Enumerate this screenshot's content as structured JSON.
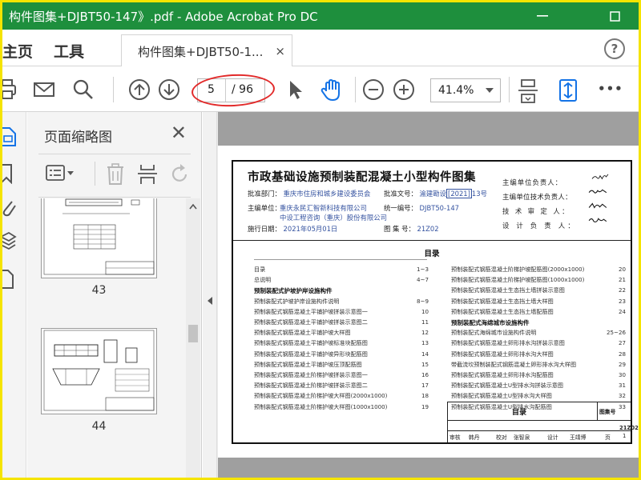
{
  "window": {
    "title": "构件图集+DJBT50-147》.pdf - Adobe Acrobat Pro DC",
    "minimize_glyph": "—",
    "maximize_glyph": "☐"
  },
  "nav": {
    "home": "主页",
    "tools": "工具",
    "tab_label": "构件图集+DJBT50-1...",
    "tab_close": "×",
    "help": "?"
  },
  "toolbar": {
    "page_current": "5",
    "page_total": "/ 96",
    "zoom": "41.4%",
    "more": "•••",
    "icons": [
      "print-icon",
      "mail-icon",
      "search-icon",
      "page-up-icon",
      "page-down-icon",
      "select-arrow-icon",
      "hand-icon",
      "zoom-out-icon",
      "zoom-in-icon",
      "fit-page-icon",
      "rotate-view-icon"
    ]
  },
  "colors": {
    "titlebar": "#1e8f3d",
    "accent_blue": "#1473e6",
    "annotation_red": "#e22a2a",
    "outer_border": "#f5e400"
  },
  "panel": {
    "title": "页面缩略图",
    "close": "✕",
    "thumbnails": [
      {
        "page": "43"
      },
      {
        "page": "44"
      }
    ]
  },
  "document": {
    "title": "市政基础设施预制装配混凝土小型构件图集",
    "approver_label": "批准部门：",
    "approver": "重庆市住房和城乡建设委员会",
    "approval_no_label": "批准文号：",
    "approval_no_a": "渝建勘设",
    "approval_no_b": "[2021]",
    "approval_no_c": "13号",
    "editor_label": "主编单位：",
    "editor_1": "重庆永民汇智新科技有限公司",
    "editor_2": "中设工程咨询（重庆）股份有限公司",
    "code_label": "统一编号：",
    "code": "DJBT50-147",
    "date_label": "施行日期：",
    "date": "2021年05月01日",
    "atlas_no_label": "图 集 号：",
    "atlas_no": "21Z02",
    "sign_roles": [
      "主编单位负责人：",
      "主编单位技术负责人：",
      "技 术 审 定 人：",
      "设 计 负 责 人："
    ],
    "toc_title": "目录",
    "toc_left": [
      {
        "text": "目录",
        "num": "1~3",
        "head": false
      },
      {
        "text": "总说明",
        "num": "4~7",
        "head": false
      },
      {
        "text": "预制装配式护坡护岸设施构件",
        "num": "",
        "head": true
      },
      {
        "text": "预制装配式护坡护岸设施构件说明",
        "num": "8~9",
        "head": false
      },
      {
        "text": "预制装配式钢筋混凝土平铺护坡拼装示意图一",
        "num": "10",
        "head": false
      },
      {
        "text": "预制装配式钢筋混凝土平铺护坡拼装示意图二",
        "num": "11",
        "head": false
      },
      {
        "text": "预制装配式钢筋混凝土平铺护坡大样图",
        "num": "12",
        "head": false
      },
      {
        "text": "预制装配式钢筋混凝土平铺护坡标准块配筋图",
        "num": "13",
        "head": false
      },
      {
        "text": "预制装配式钢筋混凝土平铺护坡异形块配筋图",
        "num": "14",
        "head": false
      },
      {
        "text": "预制装配式钢筋混凝土平铺护坡压顶配筋图",
        "num": "15",
        "head": false
      },
      {
        "text": "预制装配式钢筋混凝土阶梯护坡拼装示意图一",
        "num": "16",
        "head": false
      },
      {
        "text": "预制装配式钢筋混凝土阶梯护坡拼装示意图二",
        "num": "17",
        "head": false
      },
      {
        "text": "预制装配式钢筋混凝土阶梯护坡大样图(2000x1000)",
        "num": "18",
        "head": false
      },
      {
        "text": "预制装配式钢筋混凝土阶梯护坡大样图(1000x1000)",
        "num": "19",
        "head": false
      }
    ],
    "toc_right": [
      {
        "text": "预制装配式钢筋混凝土阶梯护坡配筋图(2000x1000)",
        "num": "20",
        "head": false
      },
      {
        "text": "预制装配式钢筋混凝土阶梯护坡配筋图(1000x1000)",
        "num": "21",
        "head": false
      },
      {
        "text": "预制装配式钢筋混凝土生态挡土墙拼装示意图",
        "num": "22",
        "head": false
      },
      {
        "text": "预制装配式钢筋混凝土生态挡土墙大样图",
        "num": "23",
        "head": false
      },
      {
        "text": "预制装配式钢筋混凝土生态挡土墙配筋图",
        "num": "24",
        "head": false
      },
      {
        "text": "预制装配式海绵城市设施构件",
        "num": "",
        "head": true
      },
      {
        "text": "预制装配式海绵城市设施构件说明",
        "num": "25~26",
        "head": false
      },
      {
        "text": "预制装配式钢筋混凝土卵形排水沟拼装示意图",
        "num": "27",
        "head": false
      },
      {
        "text": "预制装配式钢筋混凝土卵形排水沟大样图",
        "num": "28",
        "head": false
      },
      {
        "text": "带截流坎预制装配式钢筋混凝土卵形排水沟大样图",
        "num": "29",
        "head": false
      },
      {
        "text": "预制装配式钢筋混凝土卵形排水沟配筋图",
        "num": "30",
        "head": false
      },
      {
        "text": "预制装配式钢筋混凝土U型排水沟拼装示意图",
        "num": "31",
        "head": false
      },
      {
        "text": "预制装配式钢筋混凝土U型排水沟大样图",
        "num": "32",
        "head": false
      },
      {
        "text": "预制装配式钢筋混凝土U型排水沟配筋图",
        "num": "33",
        "head": false
      }
    ],
    "titleblock": {
      "title": "目录",
      "atlas_label": "图集号",
      "atlas_no": "21Z02",
      "page_label": "页",
      "page_no": "1",
      "roles": [
        "审核",
        "韩丹",
        "校对",
        "张智泉",
        "设计",
        "王靖博"
      ]
    }
  }
}
